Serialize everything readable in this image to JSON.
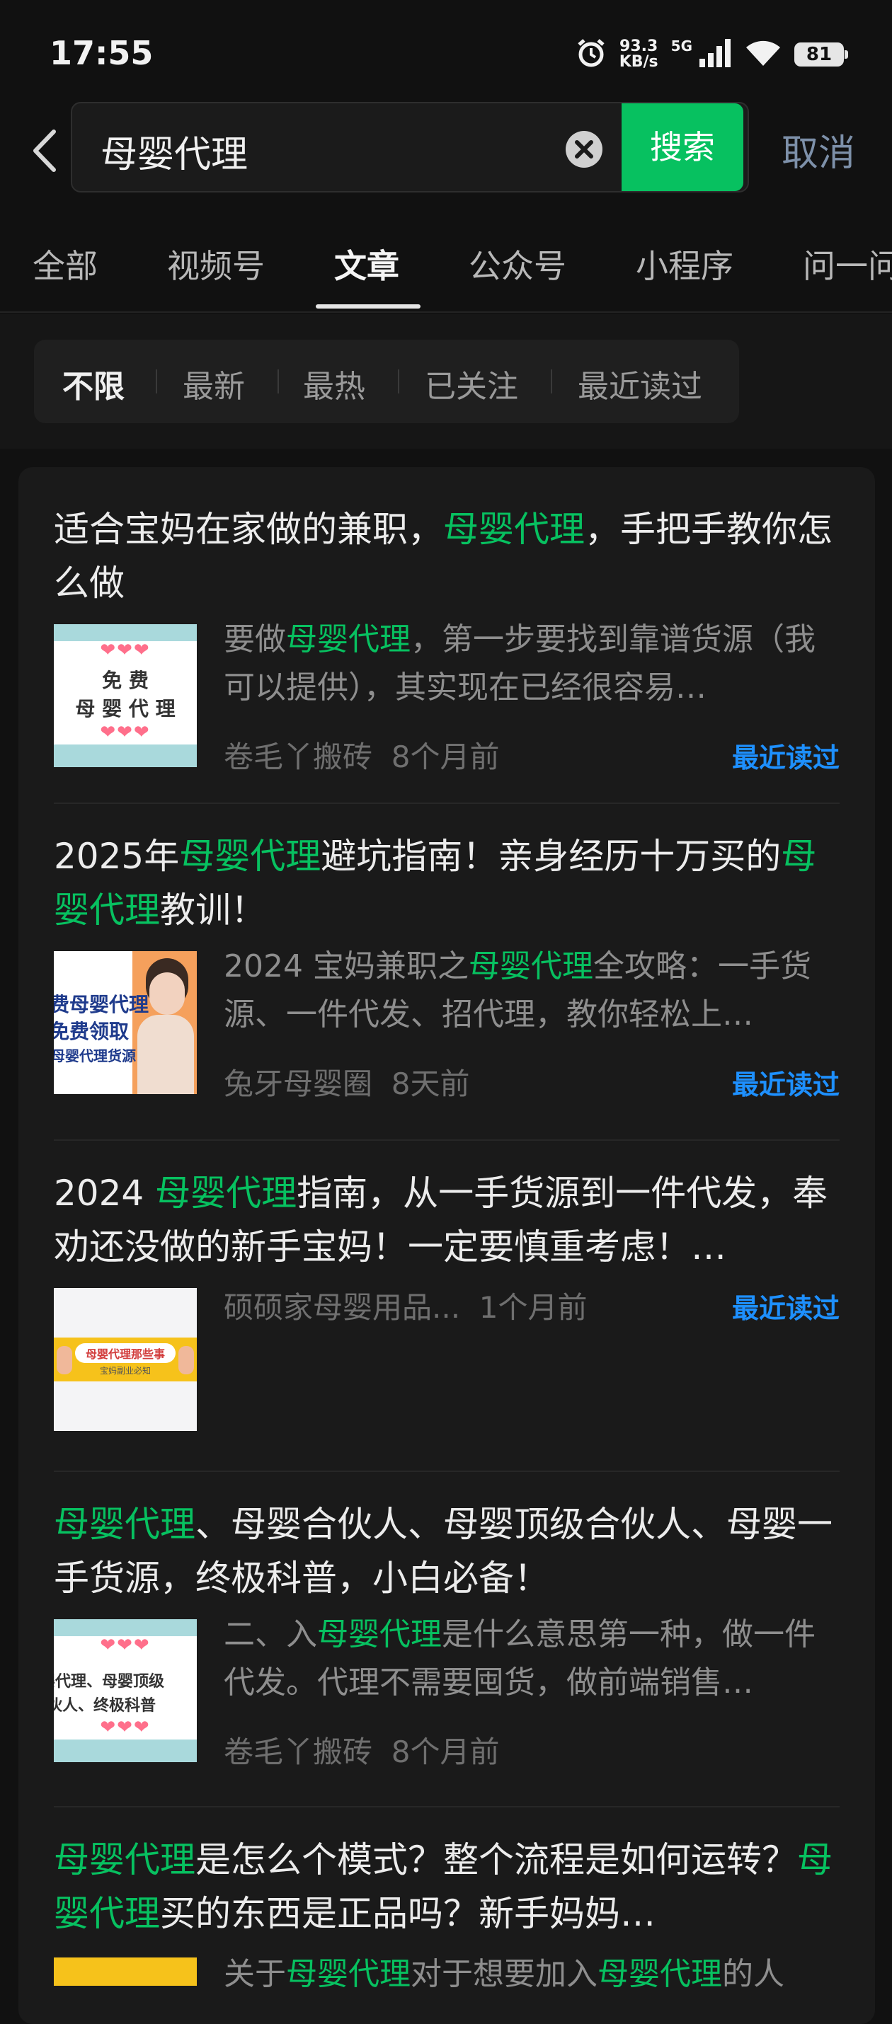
{
  "status": {
    "time": "17:55",
    "net_speed_value": "93.3",
    "net_speed_unit": "KB/s",
    "network": "5G",
    "battery": "81"
  },
  "search": {
    "query": "母婴代理",
    "button": "搜索",
    "cancel": "取消"
  },
  "tabs": [
    "全部",
    "视频号",
    "文章",
    "公众号",
    "小程序",
    "问一问"
  ],
  "active_tab": "文章",
  "filters": [
    "不限",
    "最新",
    "最热",
    "已关注",
    "最近读过"
  ],
  "active_filter": "不限",
  "accent_color": "#07c160",
  "link_color": "#1e90ff",
  "articles": [
    {
      "title_pre": "适合宝妈在家做的兼职，",
      "title_hl": "母婴代理",
      "title_post": "，手把手教你怎么做",
      "thumb_text_1": "免 费",
      "thumb_text_2": "母 婴 代 理",
      "summary_pre": "要做",
      "summary_hl": "母婴代理",
      "summary_post": "，第一步要找到靠谱货源（我可以提供），其实现在已经很容易…",
      "source": "卷毛丫搬砖",
      "time": "8个月前",
      "recent": "最近读过"
    },
    {
      "title_pre": "2025年",
      "title_hl": "母婴代理",
      "title_mid": "避坑指南！亲身经历十万买的",
      "title_hl2": "母婴代理",
      "title_post": "教训！",
      "thumb_text_1": "费母婴代理",
      "thumb_text_2": "免费领取",
      "thumb_text_3": "母婴代理货源",
      "summary_pre": "2024 宝妈兼职之",
      "summary_hl": "母婴代理",
      "summary_post": "全攻略：一手货源、一件代发、招代理，教你轻松上…",
      "source": "兔牙母婴圈",
      "time": "8天前",
      "recent": "最近读过"
    },
    {
      "title_pre": "2024 ",
      "title_hl": "母婴代理",
      "title_post": "指南，从一手货源到一件代发，奉劝还没做的新手宝妈！一定要慎重考虑！…",
      "thumb_text_1": "母婴代理那些事",
      "thumb_text_2": "宝妈副业必知",
      "source": "硕硕家母婴用品...",
      "time": "1个月前",
      "recent": "最近读过"
    },
    {
      "title_hl": "母婴代理",
      "title_post": "、母婴合伙人、母婴顶级合伙人、母婴一手货源，终极科普，小白必备！",
      "thumb_text_1": "婴代理、母婴顶级",
      "thumb_text_2": "伙人、终极科普",
      "summary_pre": "二、入",
      "summary_hl": "母婴代理",
      "summary_post": "是什么意思第一种，做一件代发。代理不需要囤货，做前端销售…",
      "source": "卷毛丫搬砖",
      "time": "8个月前"
    },
    {
      "title_hl": "母婴代理",
      "title_mid": "是怎么个模式？整个流程是如何运转？",
      "title_hl2": "母婴代理",
      "title_post": "买的东西是正品吗？新手妈妈…",
      "summary_pre": "关于",
      "summary_hl": "母婴代理",
      "summary_mid": "对于想要加入",
      "summary_hl2": "母婴代理",
      "summary_post": "的人"
    }
  ]
}
